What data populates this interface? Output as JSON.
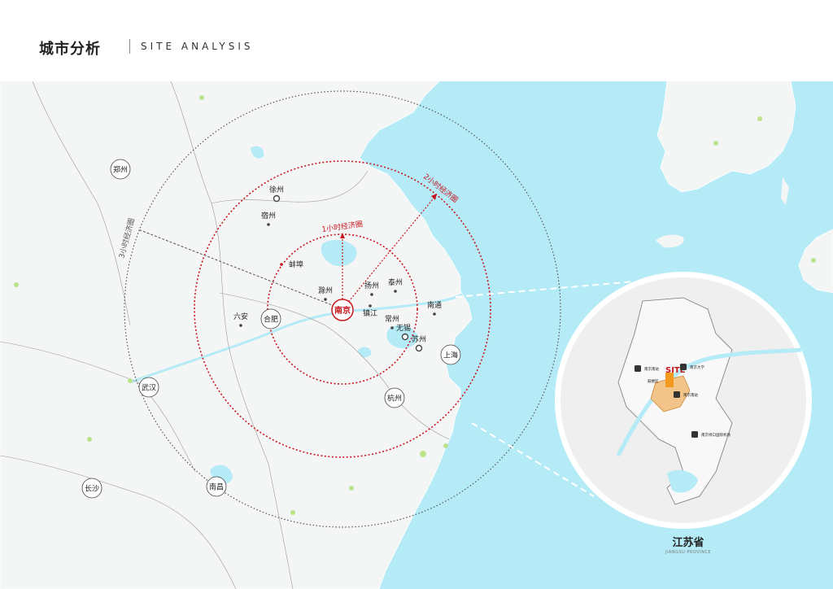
{
  "header": {
    "title_cn": "城市分析",
    "title_en": "SITE ANALYSIS"
  },
  "colors": {
    "sea": "#b4ebf7",
    "land": "#f4f5f5",
    "red_ring": "#c8161d",
    "grey_ring": "#555555",
    "site_orange": "#f39a1e",
    "inset_bg": "#f1efe9"
  },
  "rings": {
    "one_hour": "1小时经济圈",
    "two_hour": "2小时经济圈",
    "three_hour": "3小时经济圈"
  },
  "center_city": "南京",
  "cities": [
    {
      "id": "zhengzhou",
      "name": "郑州",
      "type": "circle"
    },
    {
      "id": "xuzhou",
      "name": "徐州",
      "type": "ring"
    },
    {
      "id": "suzhou-anhui",
      "name": "宿州",
      "type": "dot"
    },
    {
      "id": "bengbu",
      "name": "蚌埠",
      "type": "dot-red"
    },
    {
      "id": "chuzhou",
      "name": "滁州",
      "type": "dot"
    },
    {
      "id": "yangzhou",
      "name": "扬州",
      "type": "dot"
    },
    {
      "id": "taizhou",
      "name": "泰州",
      "type": "dot"
    },
    {
      "id": "zhenjiang",
      "name": "镇江",
      "type": "dot"
    },
    {
      "id": "nantong",
      "name": "南通",
      "type": "dot"
    },
    {
      "id": "changzhou",
      "name": "常州",
      "type": "dot"
    },
    {
      "id": "wuxi",
      "name": "无锡",
      "type": "ring"
    },
    {
      "id": "suzhou",
      "name": "苏州",
      "type": "ring"
    },
    {
      "id": "hefei",
      "name": "合肥",
      "type": "circle"
    },
    {
      "id": "luan",
      "name": "六安",
      "type": "dot"
    },
    {
      "id": "shanghai",
      "name": "上海",
      "type": "circle"
    },
    {
      "id": "hangzhou",
      "name": "杭州",
      "type": "circle"
    },
    {
      "id": "wuhan",
      "name": "武汉",
      "type": "circle"
    },
    {
      "id": "nanchang",
      "name": "南昌",
      "type": "circle"
    },
    {
      "id": "changsha",
      "name": "长沙",
      "type": "circle"
    }
  ],
  "inset": {
    "site_label": "SITE",
    "province_cn": "江苏省",
    "province_en": "JIANGSU PROVINCE",
    "labels": [
      {
        "id": "nanjing-station",
        "text": "南京南站",
        "icon": "train-icon"
      },
      {
        "id": "nanjing-university",
        "text": "南京大学",
        "icon": "bus-icon"
      },
      {
        "id": "gulou",
        "text": "鼓楼区"
      },
      {
        "id": "nanjing-south",
        "text": "南京南站",
        "icon": "train-icon"
      },
      {
        "id": "airport",
        "text": "南京禄口国际机场",
        "icon": "plane-icon"
      }
    ]
  }
}
